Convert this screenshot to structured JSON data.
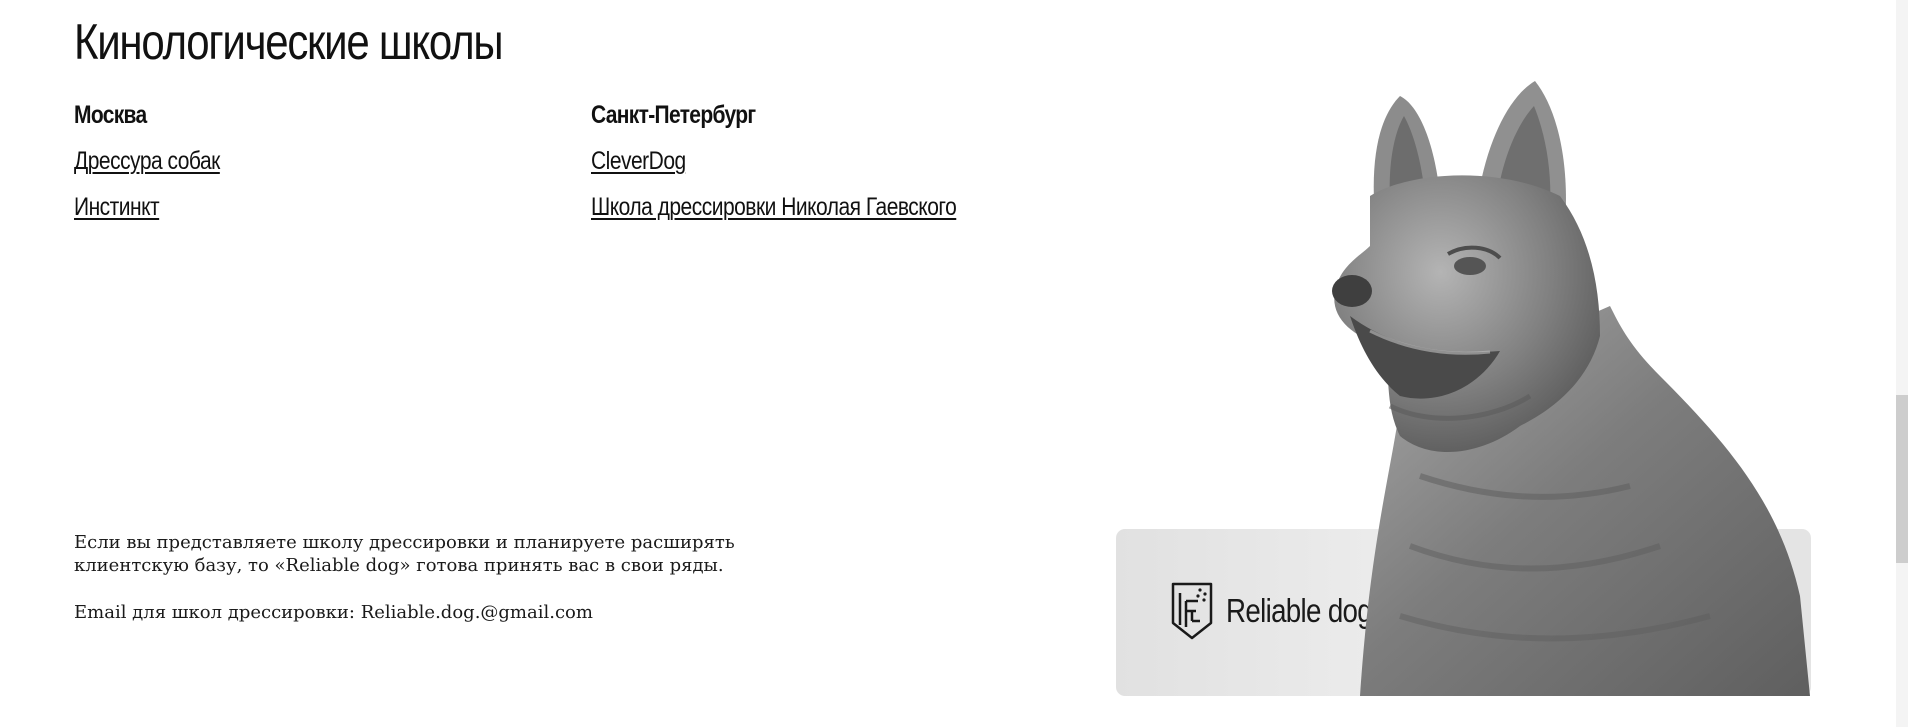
{
  "page_title": "Кинологические школы",
  "cities": [
    {
      "name": "Москва",
      "schools": [
        "Дрессура собак",
        "Инстинкт"
      ]
    },
    {
      "name": "Санкт-Петербург",
      "schools": [
        "CleverDog",
        "Школа дрессировки Николая Гаевского"
      ]
    }
  ],
  "info": {
    "invite_text": "Если вы представляете школу дрессировки и планируете расширять клиентскую базу, то «Reliable dog» готова принять вас в свои ряды.",
    "email_label": "Email для школ дрессировки: ",
    "email_value": "Reliable.dog.@gmail.com"
  },
  "brand": {
    "name": "Reliable dog",
    "logo_icon": "shield-logo-icon",
    "image_subject": "dog-statue-image"
  },
  "colors": {
    "text": "#111111",
    "card_background": "#e6e6e6",
    "statue_gray": "#8a8a8a"
  }
}
